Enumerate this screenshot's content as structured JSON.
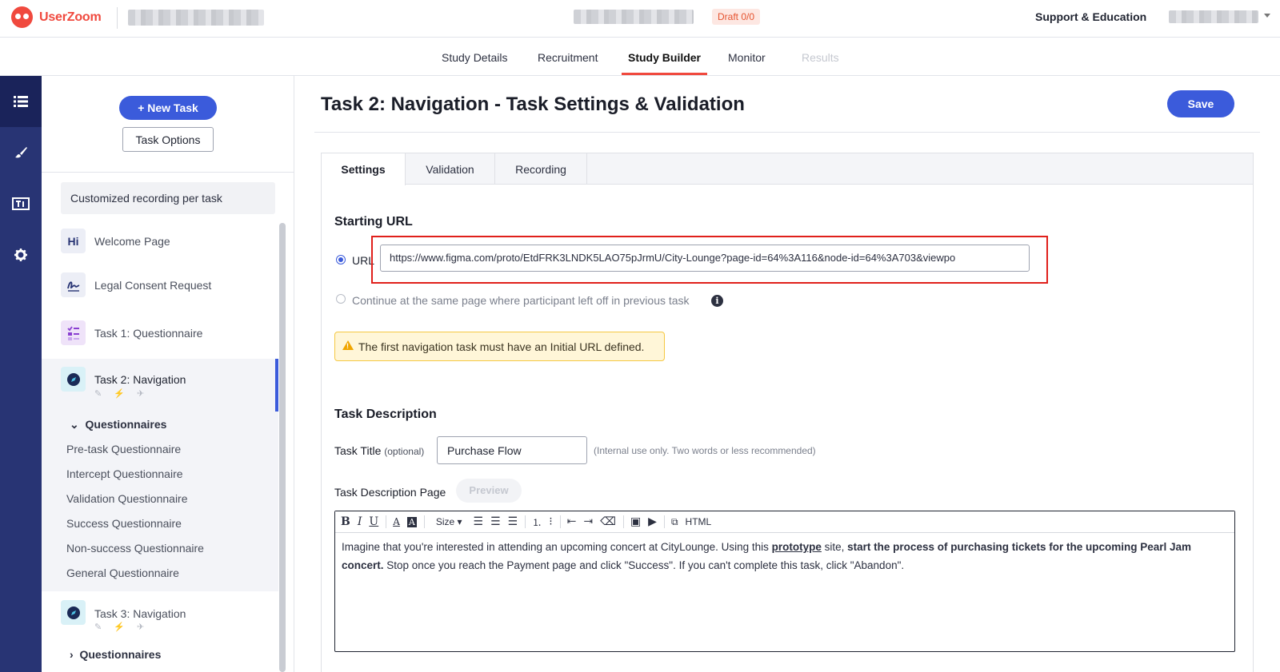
{
  "header": {
    "brand": "UserZoom",
    "draft_badge": "Draft 0/0",
    "support_link": "Support & Education"
  },
  "nav_tabs": [
    {
      "label": "Study Details",
      "state": "normal"
    },
    {
      "label": "Recruitment",
      "state": "normal"
    },
    {
      "label": "Study Builder",
      "state": "active"
    },
    {
      "label": "Monitor",
      "state": "normal"
    },
    {
      "label": "Results",
      "state": "disabled"
    }
  ],
  "rail": {
    "icons": [
      "list-icon",
      "brush-icon",
      "text-format-icon",
      "gear-icon"
    ]
  },
  "sidebar": {
    "new_task_label": "+ New Task",
    "task_options_label": "Task Options",
    "custom_recording": "Customized recording per task",
    "steps": [
      {
        "label": "Welcome Page",
        "icon": "Hi"
      },
      {
        "label": "Legal Consent Request",
        "icon": "signature-icon"
      },
      {
        "label": "Task 1: Questionnaire",
        "icon": "checklist-icon"
      },
      {
        "label": "Task 2: Navigation",
        "icon": "compass-icon",
        "selected": true
      },
      {
        "label": "Task 3: Navigation",
        "icon": "compass-icon"
      }
    ],
    "questionnaires_header": "Questionnaires",
    "questionnaires": [
      "Pre-task Questionnaire",
      "Intercept Questionnaire",
      "Validation Questionnaire",
      "Success Questionnaire",
      "Non-success Questionnaire",
      "General Questionnaire"
    ],
    "questionnaires_header_collapsed": "Questionnaires"
  },
  "main": {
    "title": "Task 2: Navigation - Task Settings & Validation",
    "save_label": "Save",
    "tabs": [
      "Settings",
      "Validation",
      "Recording"
    ],
    "starting_url": {
      "section_title": "Starting URL",
      "url_option_label": "URL",
      "url_value": "https://www.figma.com/proto/EtdFRK3LNDK5LAO75pJrmU/City-Lounge?page-id=64%3A116&node-id=64%3A703&viewpo",
      "continue_option_label": "Continue at the same page where participant left off in previous task",
      "warning": "The first navigation task must have an Initial URL defined."
    },
    "task_description": {
      "section_title": "Task Description",
      "title_label": "Task Title",
      "title_optional": "(optional)",
      "title_value": "Purchase Flow",
      "title_hint": "(Internal use only. Two words or less recommended)",
      "page_label": "Task Description Page",
      "preview_label": "Preview",
      "toolbar_size": "Size",
      "toolbar_html": "HTML",
      "body": {
        "p1": "Imagine that you're interested in attending an upcoming concert at CityLounge.  Using this ",
        "prototype": "prototype",
        "p2": " site, ",
        "bold": "start the process of purchasing tickets for the upcoming Pearl Jam concert.",
        "p3": "  Stop once you reach the Payment page and click \"Success\".  If you can't complete this task, click \"Abandon\"."
      }
    }
  }
}
